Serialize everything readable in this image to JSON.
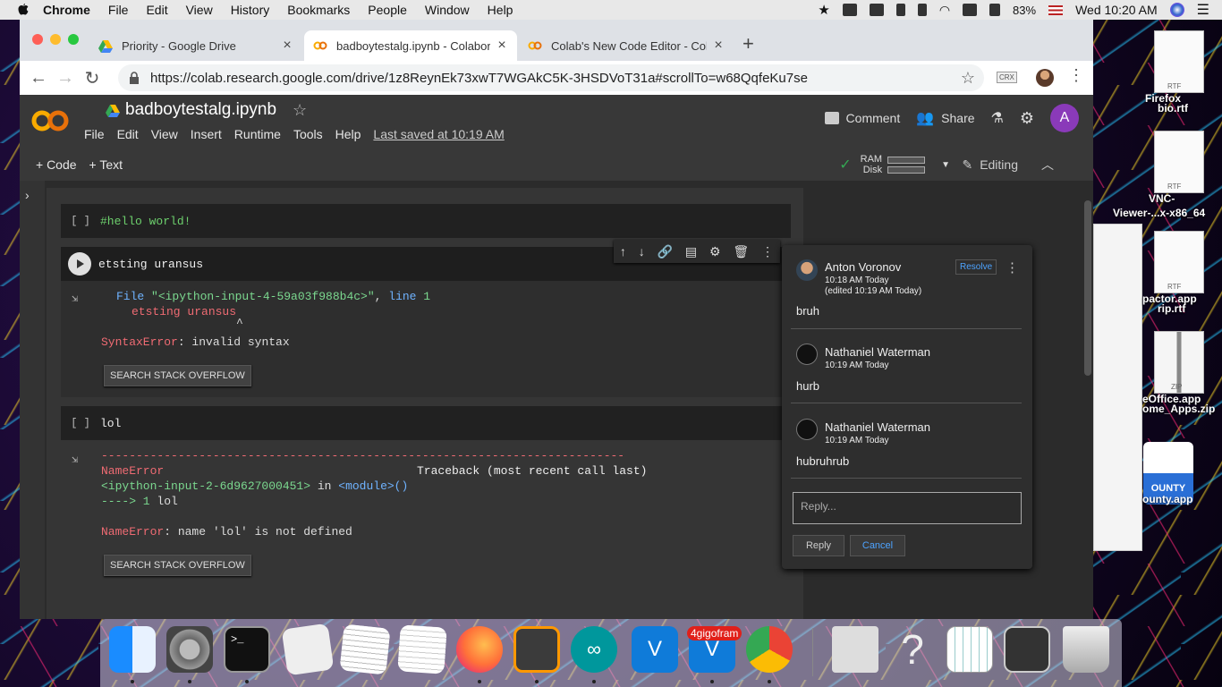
{
  "menubar": {
    "app": "Chrome",
    "items": [
      "File",
      "Edit",
      "View",
      "History",
      "Bookmarks",
      "People",
      "Window",
      "Help"
    ],
    "battery": "83%",
    "clock": "Wed 10:20 AM"
  },
  "browser": {
    "tabs": [
      {
        "title": "Priority - Google Drive",
        "close": "×"
      },
      {
        "title": "badboytestalg.ipynb - Colabora",
        "close": "×"
      },
      {
        "title": "Colab's New Code Editor - Col",
        "close": "×"
      }
    ],
    "new_tab": "+",
    "url": "https://colab.research.google.com/drive/1z8ReynEk73xwT7WGAkC5K-3HSDVoT31a#scrollTo=w68QqfeKu7se",
    "crx": "CRX"
  },
  "colab": {
    "logo_text": "CO",
    "notebook_title": "badboytestalg.ipynb",
    "menu": [
      "File",
      "Edit",
      "View",
      "Insert",
      "Runtime",
      "Tools",
      "Help"
    ],
    "last_saved": "Last saved at 10:19 AM",
    "comment_label": "Comment",
    "share_label": "Share",
    "avatar_letter": "A",
    "add_code": "+ Code",
    "add_text": "+ Text",
    "ram_label": "RAM",
    "disk_label": "Disk",
    "editing_label": "Editing"
  },
  "cells": {
    "cell1": {
      "bracket": "[ ]",
      "code": "#hello world!"
    },
    "cell2": {
      "code": "etsting uransus",
      "out_file_prefix": "File ",
      "out_file_path": "\"<ipython-input-4-59a03f988b4c>\"",
      "out_file_sep": ", ",
      "out_line_word": "line ",
      "out_line_num": "1",
      "out_code": "etsting uransus",
      "out_caret": "^",
      "error_type": "SyntaxError",
      "error_msg": ": invalid syntax",
      "so_button": "SEARCH STACK OVERFLOW"
    },
    "cell3": {
      "bracket": "[ ]",
      "code": "lol",
      "dashes": "---------------------------------------------------------------------------",
      "name_error": "NameError",
      "traceback": "Traceback (most recent call last)",
      "input_ref": "<ipython-input-2-6d9627000451>",
      "in_word": " in ",
      "module_ref": "<module>()",
      "arrow_line": "----> 1 ",
      "arrow_code": "lol",
      "final_type": "NameError",
      "final_msg": ": name 'lol' is not defined",
      "so_button": "SEARCH STACK OVERFLOW"
    }
  },
  "comments": {
    "thread": [
      {
        "name": "Anton Voronov",
        "time": "10:18 AM Today",
        "edited": "(edited 10:19 AM Today)",
        "body": "bruh"
      },
      {
        "name": "Nathaniel Waterman",
        "time": "10:19 AM Today",
        "body": "hurb"
      },
      {
        "name": "Nathaniel Waterman",
        "time": "10:19 AM Today",
        "body": "hubruhrub"
      }
    ],
    "resolve": "Resolve",
    "reply_placeholder": "Reply...",
    "reply_button": "Reply",
    "cancel_button": "Cancel"
  },
  "desktop": {
    "files": [
      {
        "label1": "Firefox",
        "label2": "bio.rtf",
        "badge": "RTF"
      },
      {
        "label1": "VNC-",
        "label2": "Viewer-...x-x86_64",
        "badge": "RTF"
      },
      {
        "label1": "pactor.app",
        "label2": "rip.rtf",
        "badge": "RTF"
      },
      {
        "label1": "eOffice.app",
        "label2": "ome_Apps.zip",
        "badge": "ZIP"
      },
      {
        "label1": "ounty.app",
        "badge": "OUNTY"
      }
    ]
  },
  "dock": {
    "badge": "4gigofram"
  }
}
